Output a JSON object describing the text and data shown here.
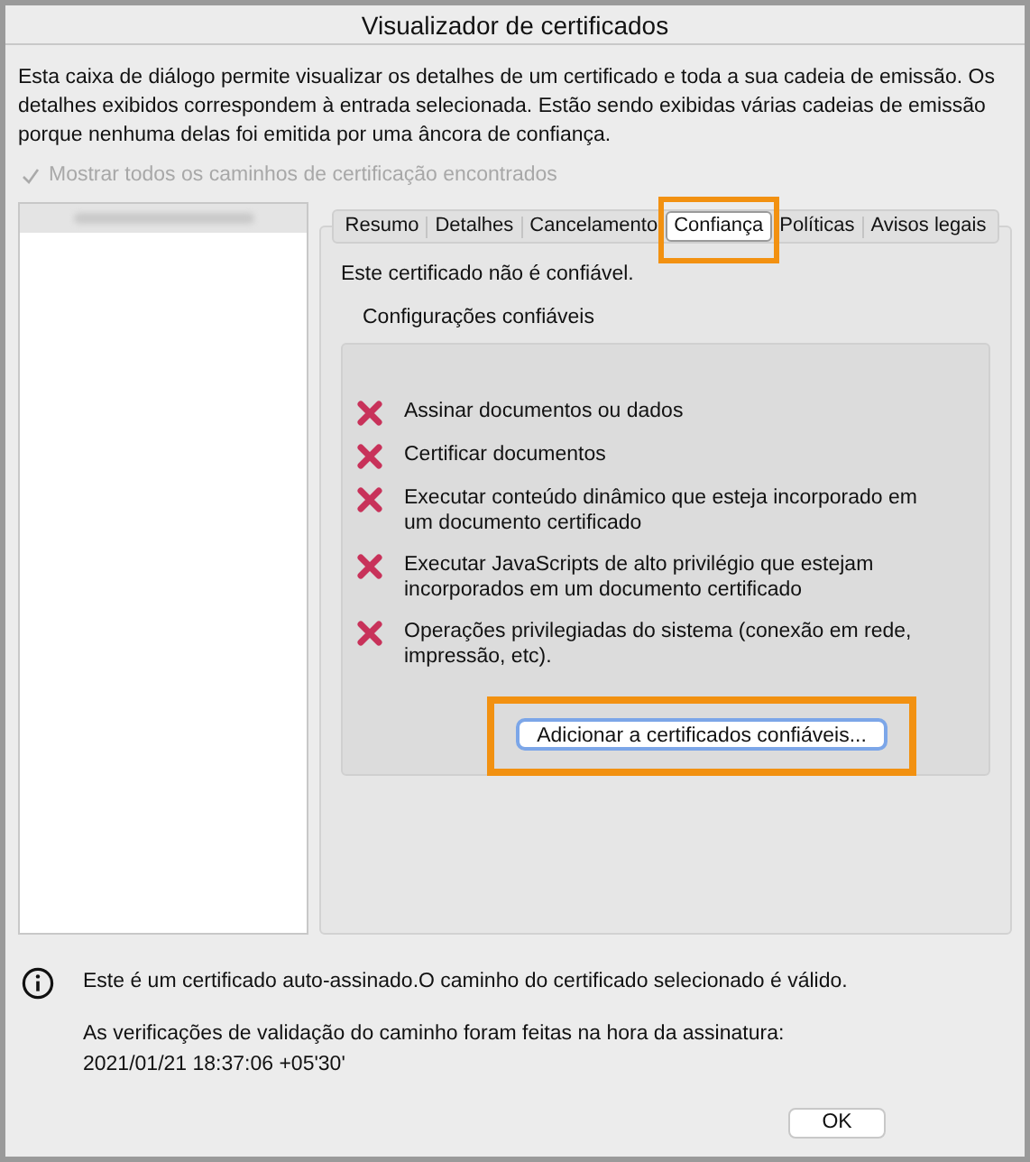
{
  "window": {
    "title": "Visualizador de certificados"
  },
  "intro": "Esta caixa de diálogo permite visualizar os detalhes de um certificado e toda a sua cadeia de emissão. Os detalhes exibidos correspondem à entrada selecionada. Estão sendo exibidas várias cadeias de emissão porque nenhuma delas foi emitida por uma âncora de confiança.",
  "show_all_paths": {
    "label": "Mostrar todos os caminhos de certificação encontrados",
    "checked": true,
    "disabled": true
  },
  "tabs": [
    {
      "label": "Resumo",
      "selected": false,
      "highlighted": false
    },
    {
      "label": "Detalhes",
      "selected": false,
      "highlighted": false
    },
    {
      "label": "Cancelamento",
      "selected": false,
      "highlighted": false
    },
    {
      "label": "Confiança",
      "selected": true,
      "highlighted": true
    },
    {
      "label": "Políticas",
      "selected": false,
      "highlighted": false
    },
    {
      "label": "Avisos legais",
      "selected": false,
      "highlighted": false
    }
  ],
  "trust": {
    "status": "Este certificado não é confiável.",
    "group_title": "Configurações confiáveis",
    "items": [
      {
        "label": "Assinar documentos ou dados",
        "allowed": false
      },
      {
        "label": "Certificar documentos",
        "allowed": false
      },
      {
        "label": "Executar conteúdo dinâmico que esteja incorporado em um documento certificado",
        "allowed": false
      },
      {
        "label": "Executar JavaScripts de alto privilégio que estejam incorporados em um documento certificado",
        "allowed": false
      },
      {
        "label": "Operações privilegiadas do sistema (conexão em rede, impressão, etc).",
        "allowed": false
      }
    ],
    "add_button": {
      "label": "Adicionar a certificados confiáveis...",
      "highlighted": true
    }
  },
  "info": {
    "message": "Este é um certificado auto-assinado.O caminho do certificado selecionado é válido.",
    "validation": "As verificações de validação do caminho foram feitas na hora da assinatura:",
    "timestamp": "2021/01/21 18:37:06 +05'30'"
  },
  "buttons": [
    {
      "label": "OK"
    }
  ]
}
